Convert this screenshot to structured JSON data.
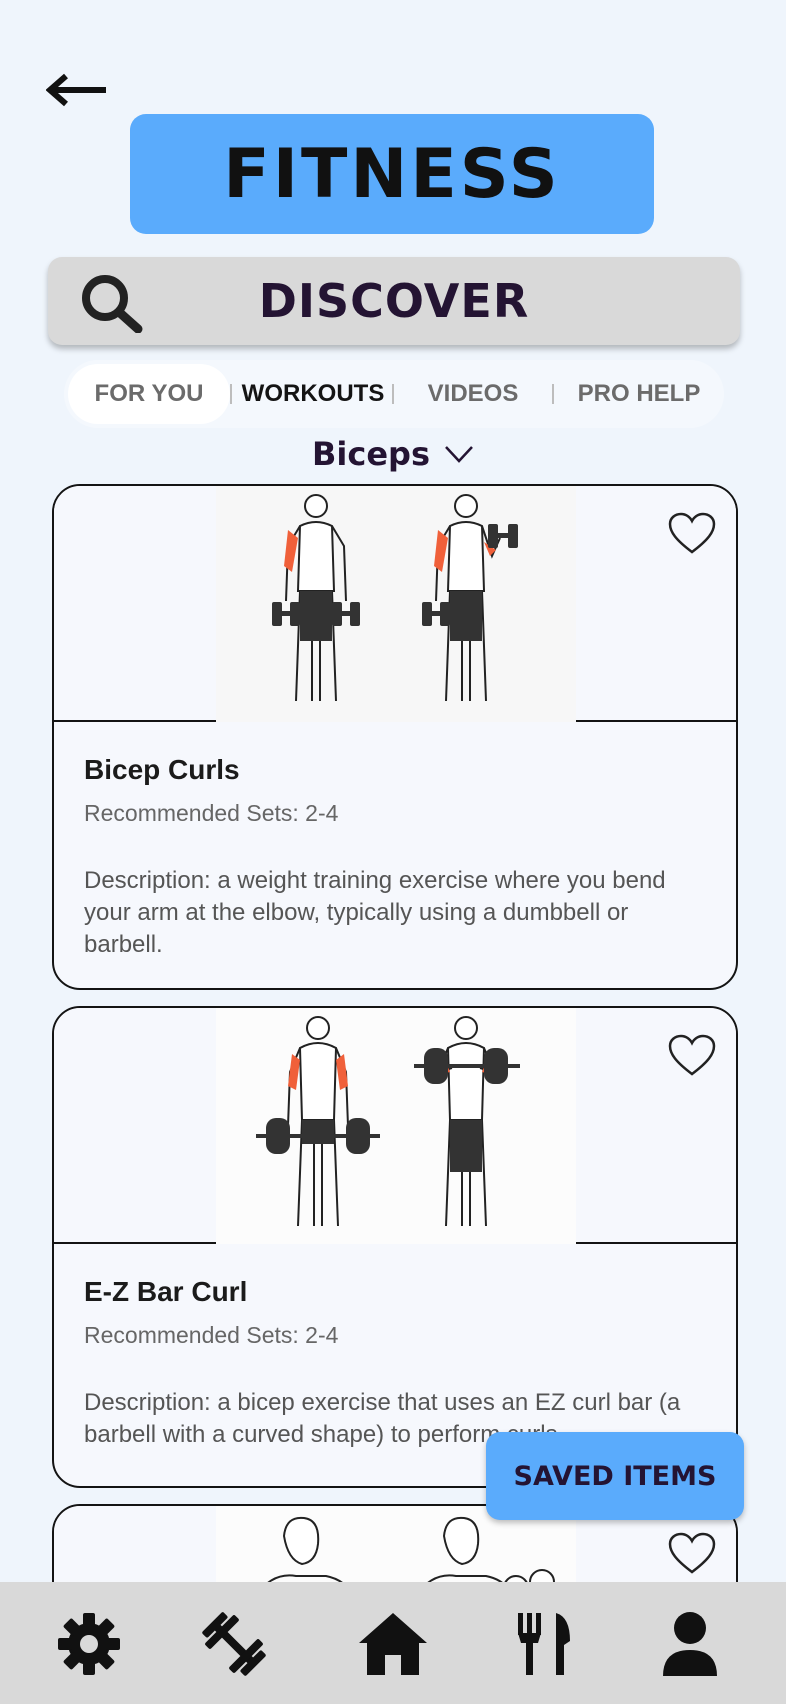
{
  "header": {
    "back_icon": "arrow-left-icon",
    "title": "FITNESS"
  },
  "search": {
    "icon": "search-icon",
    "label": "DISCOVER"
  },
  "tabs": [
    {
      "label": "FOR YOU",
      "state": "highlighted"
    },
    {
      "label": "WORKOUTS",
      "state": "selected"
    },
    {
      "label": "VIDEOS",
      "state": "normal"
    },
    {
      "label": "PRO HELP",
      "state": "normal"
    }
  ],
  "filter": {
    "label": "Biceps",
    "icon": "chevron-down-icon"
  },
  "exercises": [
    {
      "name": "Bicep Curls",
      "sets": "Recommended Sets: 2-4",
      "description": "Description: a weight training exercise where you bend your arm at the elbow, typically using a dumbbell or barbell.",
      "saved": false
    },
    {
      "name": "E-Z Bar Curl",
      "sets": "Recommended Sets: 2-4",
      "description": "Description: a bicep exercise that uses an EZ curl bar (a barbell with a curved shape) to perform curls.",
      "saved": false
    },
    {
      "name": "",
      "sets": "",
      "description": "",
      "saved": false
    }
  ],
  "saved_items_label": "SAVED ITEMS",
  "bottom_nav": [
    {
      "icon": "gear-icon"
    },
    {
      "icon": "dumbbell-icon"
    },
    {
      "icon": "home-icon"
    },
    {
      "icon": "fork-knife-icon"
    },
    {
      "icon": "person-icon"
    }
  ],
  "colors": {
    "background": "#eff5fc",
    "accent": "#5aabfc",
    "dark_text": "#241433",
    "muscle_highlight": "#f0603a"
  }
}
